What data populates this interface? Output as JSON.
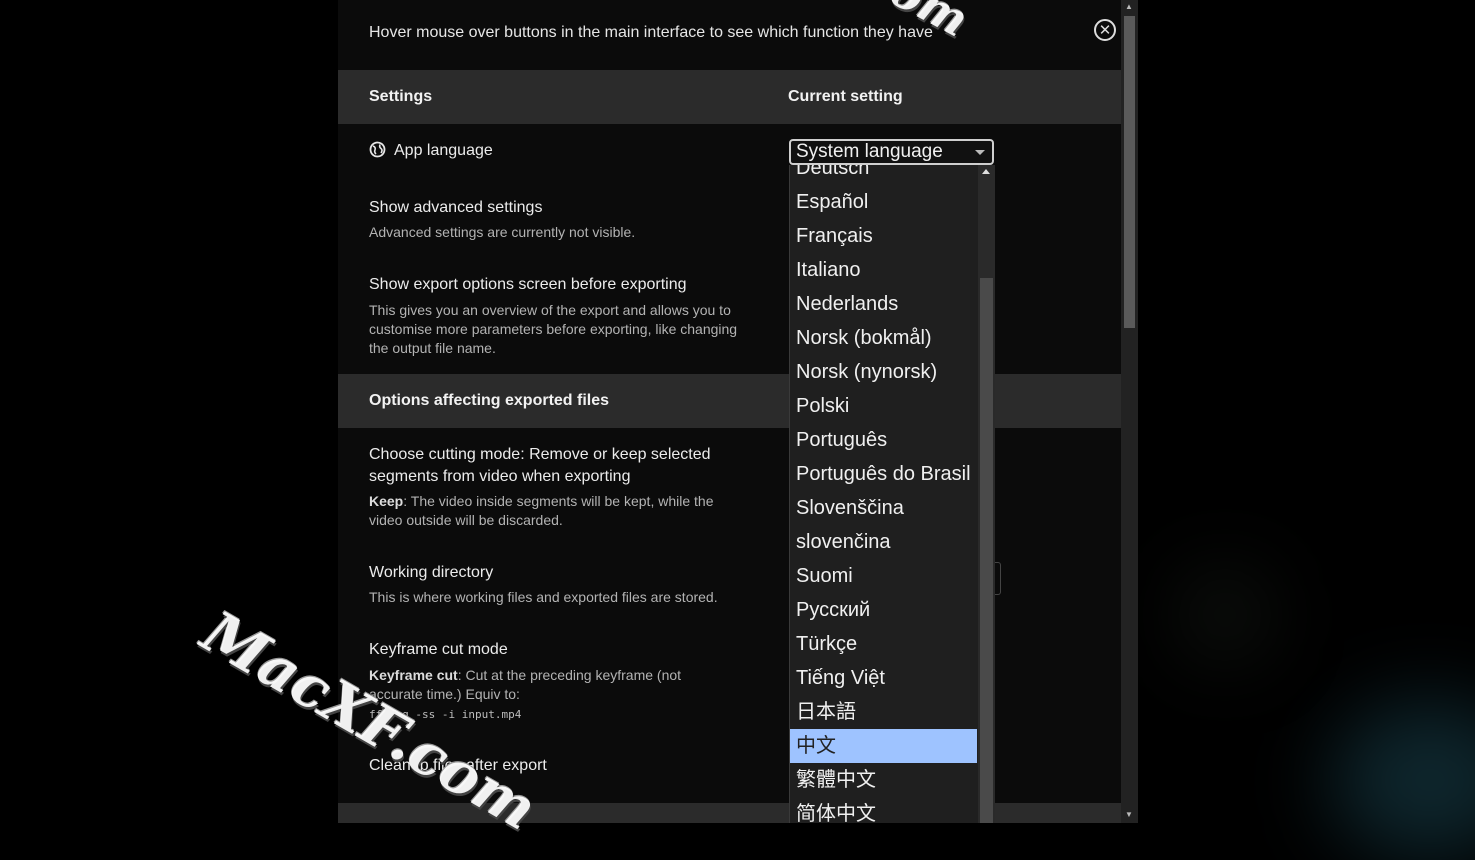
{
  "hint": "Hover mouse over buttons in the main interface to see which function they have",
  "header": {
    "settings_label": "Settings",
    "current_label": "Current setting"
  },
  "app_language": {
    "label": "App language",
    "selected": "System language"
  },
  "advanced": {
    "title": "Show advanced settings",
    "desc": "Advanced settings are currently not visible."
  },
  "export_screen": {
    "title": "Show export options screen before exporting",
    "desc": "This gives you an overview of the export and allows you to customise more parameters before exporting, like changing the output file name."
  },
  "section2": "Options affecting exported files",
  "cutting_mode": {
    "title": "Choose cutting mode: Remove or keep selected segments from video when exporting",
    "desc_bold": "Keep",
    "desc": ": The video inside segments will be kept, while the video outside will be discarded."
  },
  "working_dir": {
    "title": "Working directory",
    "desc": "This is where working files and exported files are stored."
  },
  "keyframe": {
    "title": "Keyframe cut mode",
    "desc_bold": "Keyframe cut",
    "desc": ": Cut at the preceding keyframe (not accurate time.) Equiv to:",
    "code": "ffmpeg -ss -i input.mp4"
  },
  "cleanup": {
    "title": "Cleanup files after export"
  },
  "languages": [
    "Deutsch",
    "Español",
    "Français",
    "Italiano",
    "Nederlands",
    "Norsk (bokmål)",
    "Norsk (nynorsk)",
    "Polski",
    "Português",
    "Português do Brasil",
    "Slovenščina",
    "slovenčina",
    "Suomi",
    "Русский",
    "Türkçe",
    "Tiếng Việt",
    "日本語",
    "中文",
    "繁體中文",
    "简体中文"
  ],
  "selected_language_index": 17,
  "watermark": {
    "main": "MacXF.com",
    "top": "om"
  },
  "colors": {
    "highlight": "#9ec3ff",
    "section_bg": "#2b2b2b"
  }
}
